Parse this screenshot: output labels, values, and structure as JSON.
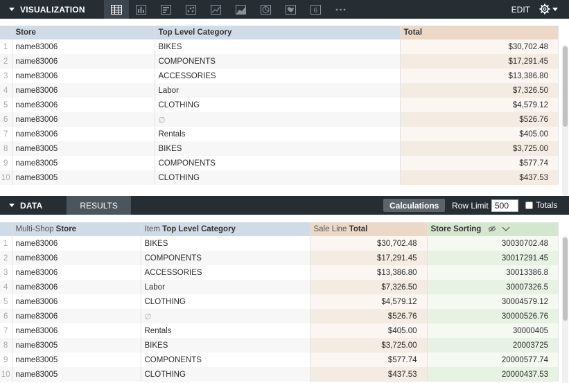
{
  "visualization_bar": {
    "title": "VISUALIZATION",
    "edit_label": "EDIT",
    "icons": [
      "table-icon",
      "bar-chart-icon",
      "column-chart-icon",
      "scatter-icon",
      "line-chart-icon",
      "area-chart-icon",
      "pie-chart-icon",
      "map-icon",
      "single-value-icon",
      "more-icon"
    ]
  },
  "viz_table": {
    "columns": [
      "Store",
      "Top Level Category",
      "Total"
    ],
    "rows": [
      {
        "n": "1",
        "store": "name83006",
        "category": "BIKES",
        "total": "$30,702.48"
      },
      {
        "n": "2",
        "store": "name83006",
        "category": "COMPONENTS",
        "total": "$17,291.45"
      },
      {
        "n": "3",
        "store": "name83006",
        "category": "ACCESSORIES",
        "total": "$13,386.80"
      },
      {
        "n": "4",
        "store": "name83006",
        "category": "Labor",
        "total": "$7,326.50"
      },
      {
        "n": "5",
        "store": "name83006",
        "category": "CLOTHING",
        "total": "$4,579.12"
      },
      {
        "n": "6",
        "store": "name83006",
        "category": "∅",
        "total": "$526.76"
      },
      {
        "n": "7",
        "store": "name83006",
        "category": "Rentals",
        "total": "$405.00"
      },
      {
        "n": "8",
        "store": "name83005",
        "category": "BIKES",
        "total": "$3,725.00"
      },
      {
        "n": "9",
        "store": "name83005",
        "category": "COMPONENTS",
        "total": "$577.74"
      },
      {
        "n": "10",
        "store": "name83005",
        "category": "CLOTHING",
        "total": "$437.53"
      }
    ]
  },
  "data_bar": {
    "title": "DATA",
    "results_tab": "RESULTS",
    "calculations_button": "Calculations",
    "row_limit_label": "Row Limit",
    "row_limit_value": "500",
    "totals_label": "Totals"
  },
  "data_table": {
    "columns": [
      {
        "prefix": "Multi-Shop",
        "name": "Store"
      },
      {
        "prefix": "Item",
        "name": "Top Level Category"
      },
      {
        "prefix": "Sale Line",
        "name": "Total"
      },
      {
        "prefix": "",
        "name": "Store Sorting"
      }
    ],
    "rows": [
      {
        "n": "1",
        "store": "name83006",
        "category": "BIKES",
        "total": "$30,702.48",
        "sorting": "30030702.48"
      },
      {
        "n": "2",
        "store": "name83006",
        "category": "COMPONENTS",
        "total": "$17,291.45",
        "sorting": "30017291.45"
      },
      {
        "n": "3",
        "store": "name83006",
        "category": "ACCESSORIES",
        "total": "$13,386.80",
        "sorting": "30013386.8"
      },
      {
        "n": "4",
        "store": "name83006",
        "category": "Labor",
        "total": "$7,326.50",
        "sorting": "30007326.5"
      },
      {
        "n": "5",
        "store": "name83006",
        "category": "CLOTHING",
        "total": "$4,579.12",
        "sorting": "30004579.12"
      },
      {
        "n": "6",
        "store": "name83006",
        "category": "∅",
        "total": "$526.76",
        "sorting": "30000526.76"
      },
      {
        "n": "7",
        "store": "name83006",
        "category": "Rentals",
        "total": "$405.00",
        "sorting": "30000405"
      },
      {
        "n": "8",
        "store": "name83005",
        "category": "BIKES",
        "total": "$3,725.00",
        "sorting": "20003725"
      },
      {
        "n": "9",
        "store": "name83005",
        "category": "COMPONENTS",
        "total": "$577.74",
        "sorting": "20000577.74"
      },
      {
        "n": "10",
        "store": "name83005",
        "category": "CLOTHING",
        "total": "$437.53",
        "sorting": "20000437.53"
      }
    ]
  },
  "colors": {
    "bar_background": "#262d33",
    "dimension_header": "#cfdbe6",
    "measure_header": "#ecd8c6",
    "calculation_header": "#d5e6cf"
  }
}
